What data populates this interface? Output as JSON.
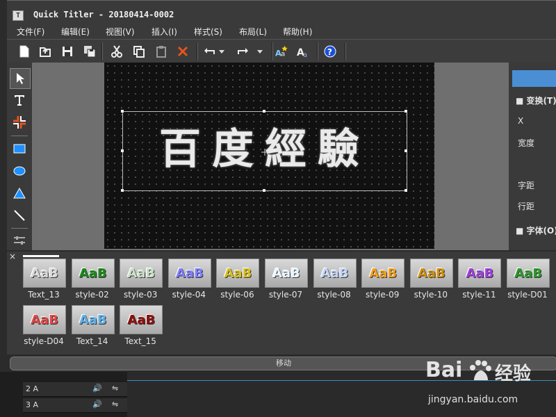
{
  "window": {
    "title": "Quick Titler - 20180414-0002"
  },
  "menu": [
    "文件(F)",
    "编辑(E)",
    "视图(V)",
    "插入(I)",
    "样式(S)",
    "布局(L)",
    "帮助(H)"
  ],
  "canvas": {
    "title_text": "百度經驗"
  },
  "properties": {
    "header": "",
    "section_transform": "变换(T)",
    "x_label": "X",
    "width_label": "宽度",
    "char_spacing_label": "字距",
    "line_spacing_label": "行距",
    "section_font": "字体(O)"
  },
  "styles": {
    "close": "×",
    "row1": [
      {
        "label": "Text_13"
      },
      {
        "label": "style-02"
      },
      {
        "label": "style-03"
      },
      {
        "label": "style-04"
      },
      {
        "label": "style-06"
      },
      {
        "label": "style-07"
      },
      {
        "label": "style-08"
      },
      {
        "label": "style-09"
      },
      {
        "label": "style-10"
      },
      {
        "label": "style-11"
      },
      {
        "label": "style-D01"
      }
    ],
    "row2": [
      {
        "label": "style-D04"
      },
      {
        "label": "Text_14"
      },
      {
        "label": "Text_15"
      }
    ],
    "swatch_text": "AaB",
    "colors": [
      "#d8d8d8",
      "#1e8a1e",
      "#c8e0c8",
      "#8080ff",
      "#d6c020",
      "#e8f4ff",
      "#c0d4f4",
      "#f0a020",
      "#d09010",
      "#a040e0",
      "#2e9a2e",
      "#e04848",
      "#60b0e8",
      "#901010"
    ]
  },
  "move_label": "移动",
  "timeline": {
    "tracks": [
      "2 A",
      "3 A"
    ]
  },
  "watermark": {
    "brand": "Bai",
    "brand2": "经验",
    "url": "jingyan.baidu.com"
  }
}
